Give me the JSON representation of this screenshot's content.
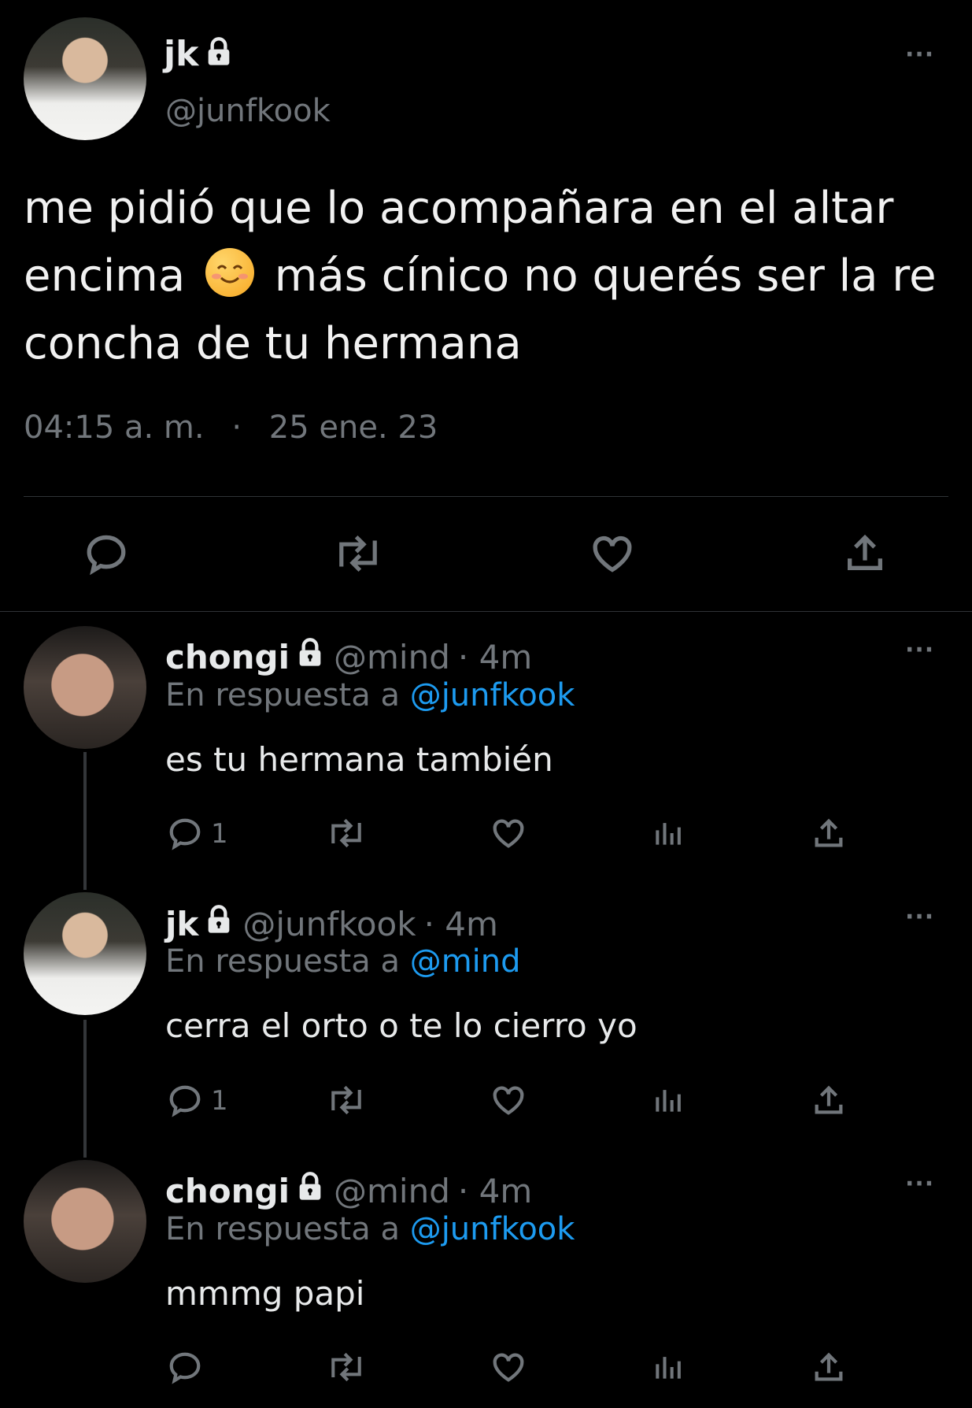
{
  "main_tweet": {
    "display_name": "jk",
    "handle": "@junfkook",
    "text_line1": "me pidió que lo acompañara en el altar",
    "text_line2_a": "encima",
    "emoji": "☺️",
    "text_line2_b": "más cínico no querés ser la re",
    "text_line3": "concha de tu hermana",
    "time": "04:15 a. m.",
    "separator": "·",
    "date": "25 ene. 23",
    "more": "···"
  },
  "replies": [
    {
      "display_name": "chongi",
      "handle": "@mind",
      "age": "· 4m",
      "reply_prefix": "En respuesta a",
      "reply_to": "@junfkook",
      "text": "es tu hermana también",
      "reply_count": "1",
      "more": "···"
    },
    {
      "display_name": "jk",
      "handle": "@junfkook",
      "age": "· 4m",
      "reply_prefix": "En respuesta a",
      "reply_to": "@mind",
      "text": "cerra el orto o te lo cierro yo",
      "reply_count": "1",
      "more": "···"
    },
    {
      "display_name": "chongi",
      "handle": "@mind",
      "age": "· 4m",
      "reply_prefix": "En respuesta a",
      "reply_to": "@junfkook",
      "text": "mmmg papi",
      "reply_count": "",
      "more": "···"
    }
  ],
  "colors": {
    "background": "#000000",
    "text": "#e7e9ea",
    "muted": "#71767b",
    "link": "#1d9bf0",
    "divider": "#2f3336"
  },
  "icons": [
    "lock-icon",
    "more-icon",
    "reply-icon",
    "retweet-icon",
    "like-icon",
    "views-icon",
    "share-icon"
  ]
}
